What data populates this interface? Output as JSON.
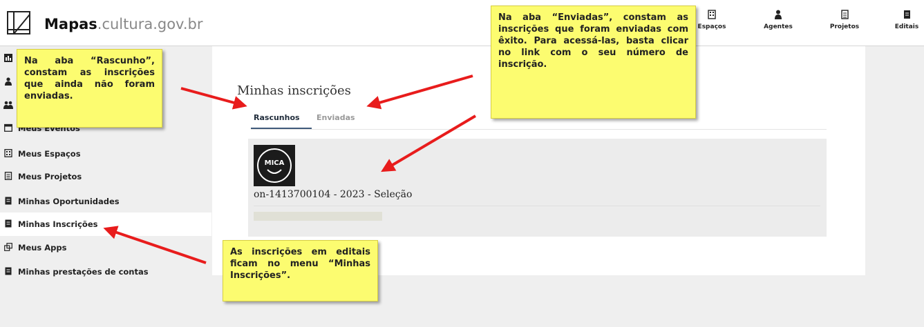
{
  "header": {
    "brand_strong": "Mapas",
    "brand_light": ".cultura.gov.br",
    "nav": [
      {
        "label": "Espaços",
        "icon": "building-icon"
      },
      {
        "label": "Agentes",
        "icon": "person-icon"
      },
      {
        "label": "Projetos",
        "icon": "document-icon"
      },
      {
        "label": "Editais",
        "icon": "book-icon"
      }
    ]
  },
  "sidebar": {
    "items": [
      {
        "label": "Meus Eventos",
        "icon": "calendar-icon"
      },
      {
        "label": "Meus Espaços",
        "icon": "building-icon"
      },
      {
        "label": "Meus Projetos",
        "icon": "document-icon"
      },
      {
        "label": "Minhas Oportunidades",
        "icon": "book-icon"
      },
      {
        "label": "Minhas Inscrições",
        "icon": "book-icon",
        "active": true
      },
      {
        "label": "Meus Apps",
        "icon": "apps-icon"
      },
      {
        "label": "Minhas prestações de contas",
        "icon": "book-icon"
      }
    ]
  },
  "main": {
    "title": "Minhas inscrições",
    "tabs": [
      {
        "label": "Rascunhos",
        "active": true
      },
      {
        "label": "Enviadas",
        "active": false
      }
    ],
    "card": {
      "logo_text": "MICA",
      "registration": "on-1413700104 - 2023 - Seleção"
    }
  },
  "callouts": {
    "rascunho": "Na aba “Rascunho”, constam as inscrições que ainda não foram enviadas.",
    "enviadas": "Na aba “Enviadas”, constam as inscrições que foram enviadas com êxito. Para acessá-las, basta clicar no link com o seu número de inscrição.",
    "menu": "As inscrições em editais ficam no menu “Minhas Inscrições”."
  },
  "colors": {
    "callout_bg": "#fcfc70",
    "arrow": "#e81c1c",
    "tab_underline": "#3f5a7a"
  }
}
